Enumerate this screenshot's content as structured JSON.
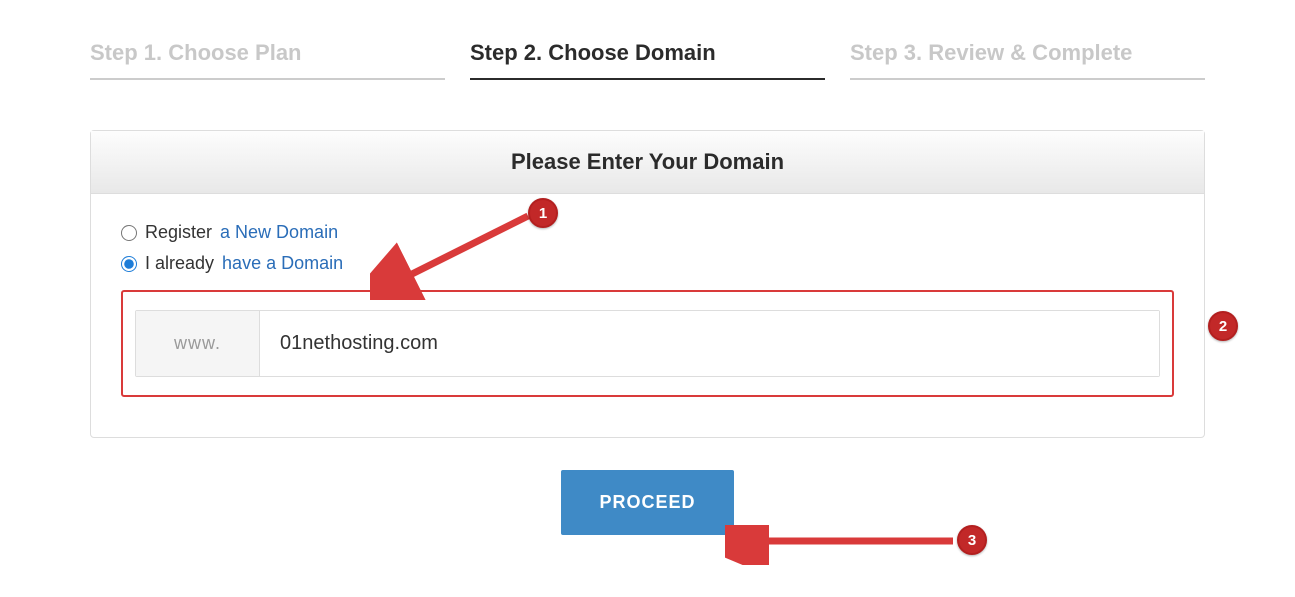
{
  "steps": {
    "s1": "Step 1. Choose Plan",
    "s2": "Step 2. Choose Domain",
    "s3": "Step 3. Review & Complete"
  },
  "panel": {
    "title": "Please Enter Your Domain"
  },
  "options": {
    "register_prefix": "Register",
    "register_link": "a New Domain",
    "have_prefix": "I already",
    "have_link": "have a Domain"
  },
  "input": {
    "prefix": "www.",
    "value": "01nethosting.com"
  },
  "button": {
    "proceed": "PROCEED"
  },
  "annotations": {
    "b1": "1",
    "b2": "2",
    "b3": "3"
  }
}
